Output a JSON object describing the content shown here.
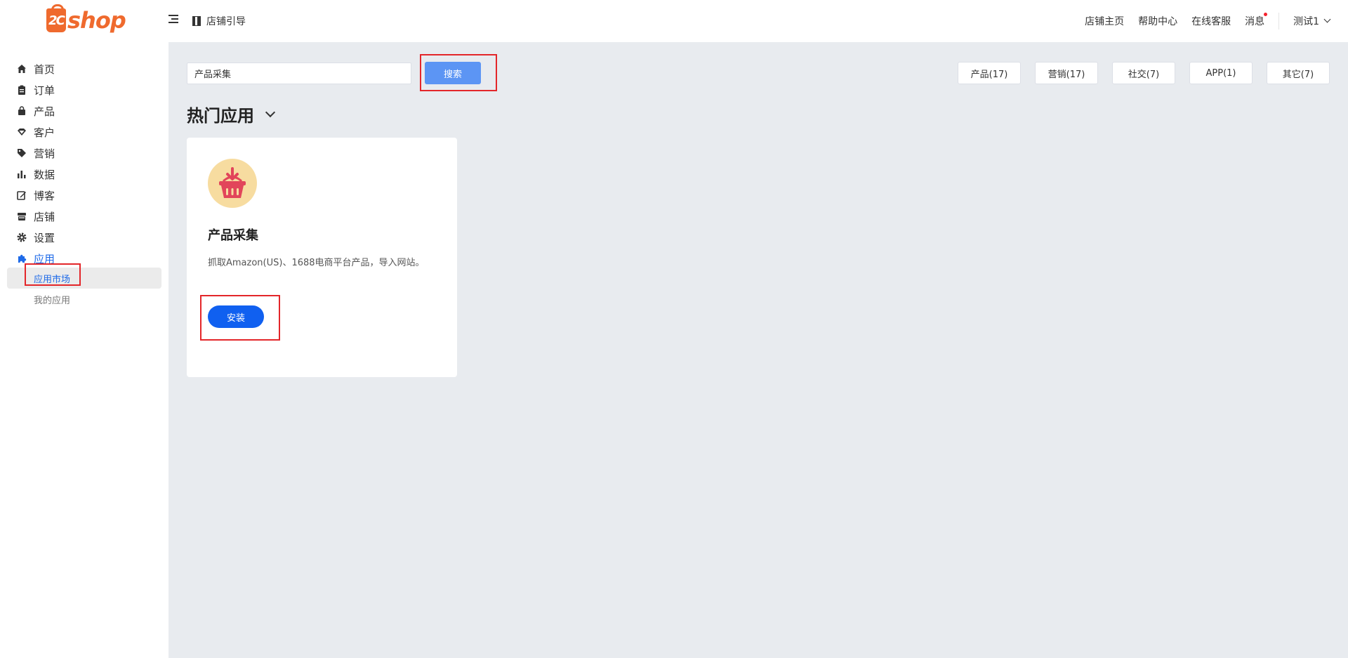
{
  "header": {
    "logo_badge": "2C",
    "logo_text": "shop",
    "guide_label": "店铺引导",
    "links": [
      "店铺主页",
      "帮助中心",
      "在线客服",
      "消息"
    ],
    "user": "测试1"
  },
  "sidebar": {
    "items": [
      {
        "label": "首页",
        "icon": "home-icon"
      },
      {
        "label": "订单",
        "icon": "clipboard-icon"
      },
      {
        "label": "产品",
        "icon": "bag-icon"
      },
      {
        "label": "客户",
        "icon": "diamond-icon"
      },
      {
        "label": "营销",
        "icon": "tag-icon"
      },
      {
        "label": "数据",
        "icon": "bar-chart-icon"
      },
      {
        "label": "博客",
        "icon": "edit-icon"
      },
      {
        "label": "店铺",
        "icon": "store-icon"
      },
      {
        "label": "设置",
        "icon": "gear-icon"
      },
      {
        "label": "应用",
        "icon": "puzzle-icon"
      }
    ],
    "sub_items": [
      "应用市场",
      "我的应用"
    ]
  },
  "search": {
    "value": "产品采集",
    "button": "搜索"
  },
  "categories": [
    "产品(17)",
    "营销(17)",
    "社交(7)",
    "APP(1)",
    "其它(7)"
  ],
  "section": {
    "title": "热门应用"
  },
  "app_card": {
    "title": "产品采集",
    "description": "抓取Amazon(US)、1688电商平台产品，导入网站。",
    "install": "安装"
  },
  "colors": {
    "brand": "#ef6a2e",
    "accent": "#1e6ae8",
    "install_button": "#1060f0",
    "search_button": "#5c95f4",
    "highlight": "#e3262a"
  }
}
